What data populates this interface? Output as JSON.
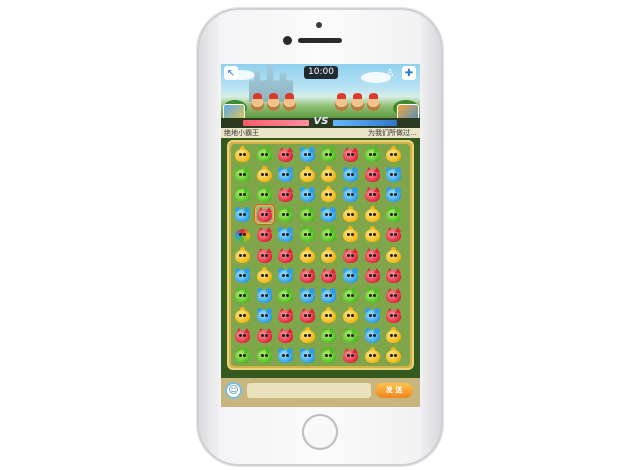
{
  "header": {
    "timer": "10:00",
    "vs_label": "VS",
    "back_icon": "back-arrow-icon",
    "friend_icon": "add-friend-icon",
    "rank_icon": "trophy-icon"
  },
  "players": {
    "left_name": "绝地小霸王",
    "right_name": "为我们所做过…"
  },
  "board": {
    "rows": [
      [
        "yellow",
        "green",
        "red",
        "blue",
        "green",
        "red",
        "green",
        "yellow"
      ],
      [
        "green",
        "yellow",
        "blue",
        "yellow",
        "yellow",
        "blue",
        "red",
        "blue"
      ],
      [
        "green",
        "green",
        "red",
        "blue",
        "yellow",
        "blue",
        "red",
        "blue"
      ],
      [
        "blue",
        "red",
        "green",
        "green",
        "blue",
        "yellow",
        "yellow",
        "green"
      ],
      [
        "special",
        "red",
        "blue",
        "green",
        "green",
        "yellow",
        "yellow",
        "red"
      ],
      [
        "yellow",
        "red",
        "red",
        "yellow",
        "yellow",
        "red",
        "red",
        "yellow"
      ],
      [
        "blue",
        "yellow",
        "blue",
        "red",
        "red",
        "blue",
        "red",
        "red"
      ],
      [
        "green",
        "blue",
        "green",
        "blue",
        "blue",
        "green",
        "green",
        "red"
      ],
      [
        "yellow",
        "blue",
        "red",
        "red",
        "yellow",
        "yellow",
        "blue",
        "red"
      ],
      [
        "red",
        "red",
        "red",
        "yellow",
        "green",
        "green",
        "blue",
        "yellow"
      ],
      [
        "green",
        "green",
        "blue",
        "blue",
        "green",
        "red",
        "yellow",
        "yellow"
      ]
    ],
    "selected": [
      3,
      1
    ]
  },
  "chat": {
    "emoji_icon": "smiley-icon",
    "input_value": "",
    "send_label": "发 送"
  },
  "colors": {
    "yellow": "#f4b512",
    "green": "#4fbf25",
    "red": "#e2253b",
    "blue": "#2d9ee8",
    "left_bar": "#ff5b6c",
    "right_bar": "#2f78c9",
    "send_button": "#f0861d"
  }
}
